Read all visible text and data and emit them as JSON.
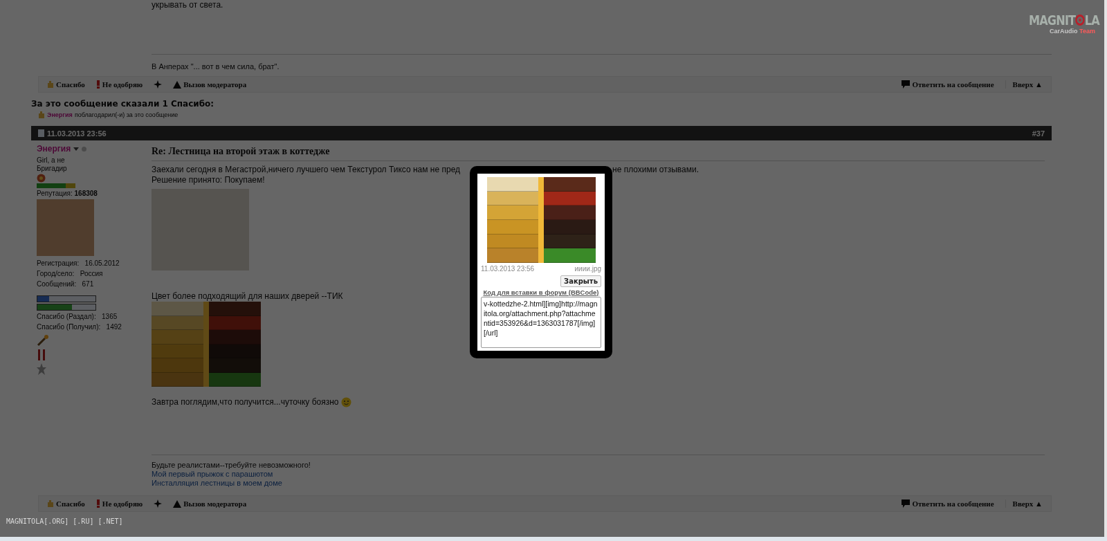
{
  "prev_post": {
    "text_tail": "укрывать от света.",
    "signature": "В Анперах \"... вот в чем сила, брат\"."
  },
  "action_bars": [
    {
      "thanks": "Спасибо",
      "disapprove": "Не одобряю",
      "moderator": "Вызов модератора",
      "reply": "Ответить на сообщение",
      "top": "Вверх ▲"
    },
    {
      "thanks": "Спасибо",
      "disapprove": "Не одобряю",
      "moderator": "Вызов модератора",
      "reply": "Ответить на сообщение",
      "top": "Вверх ▲"
    }
  ],
  "thanks_block": {
    "heading": "За это сообщение сказали 1 Спасибо:",
    "entries": [
      {
        "user": "Энергия",
        "text": "поблагодарил(-и) за это сообщение"
      }
    ]
  },
  "post": {
    "date": "11.03.2013 23:56",
    "number": "#37",
    "user": {
      "name": "Энергия",
      "title": "Girl, а не Бригадир",
      "reputation_label": "Репутация:",
      "reputation": "168308",
      "stats": [
        {
          "label": "Регистрация:",
          "value": "16.05.2012"
        },
        {
          "label": "Город/село:",
          "value": "Россия"
        },
        {
          "label": "Сообщений:",
          "value": "671"
        }
      ],
      "bars": [
        {
          "kind": "blue",
          "level": 0.2
        },
        {
          "kind": "green",
          "level": 0.6
        }
      ],
      "thanks_stats": [
        {
          "label": "Спасибо (Раздал):",
          "value": "1365"
        },
        {
          "label": "Спасибо (Получил):",
          "value": "1492"
        }
      ]
    },
    "title": "Re: Лестница на второй этаж в коттедже",
    "intro_start": "Заехали сегодня в Мегастрой,ничего лучшего чем Текстурол Тиксо нам не пред",
    "intro_end": "не плохими отзывами.",
    "decision": "Решение принято: Покупаем!",
    "caption": "Цвет более подходящий для наших дверей --ТИК",
    "closing": "Завтра поглядим,что получится...чуточку боязно",
    "signature_lines": [
      "Будьте реалистами--требуйте невозможного!",
      "Мой первый прыжок с парашютом",
      "Инсталляция лестницы в моем доме"
    ]
  },
  "lightbox": {
    "date": "11.03.2013 23:56",
    "filename": "ииии.jpg",
    "close": "Закрыть",
    "code_label": "Код для вставки в форум (BBCode)",
    "code_value": "v-kottedzhe-2.html][img]http://magnitola.org/attachment.php?attachmentid=353926&d=1363031787[/img][/url]"
  },
  "logo": {
    "left": "MAGNIT",
    "right": "LA",
    "sub_1": "CarAudio",
    "sub_2": "Team"
  },
  "footer_domain": "MAGNITOLA[.ORG] [.RU] [.NET]"
}
